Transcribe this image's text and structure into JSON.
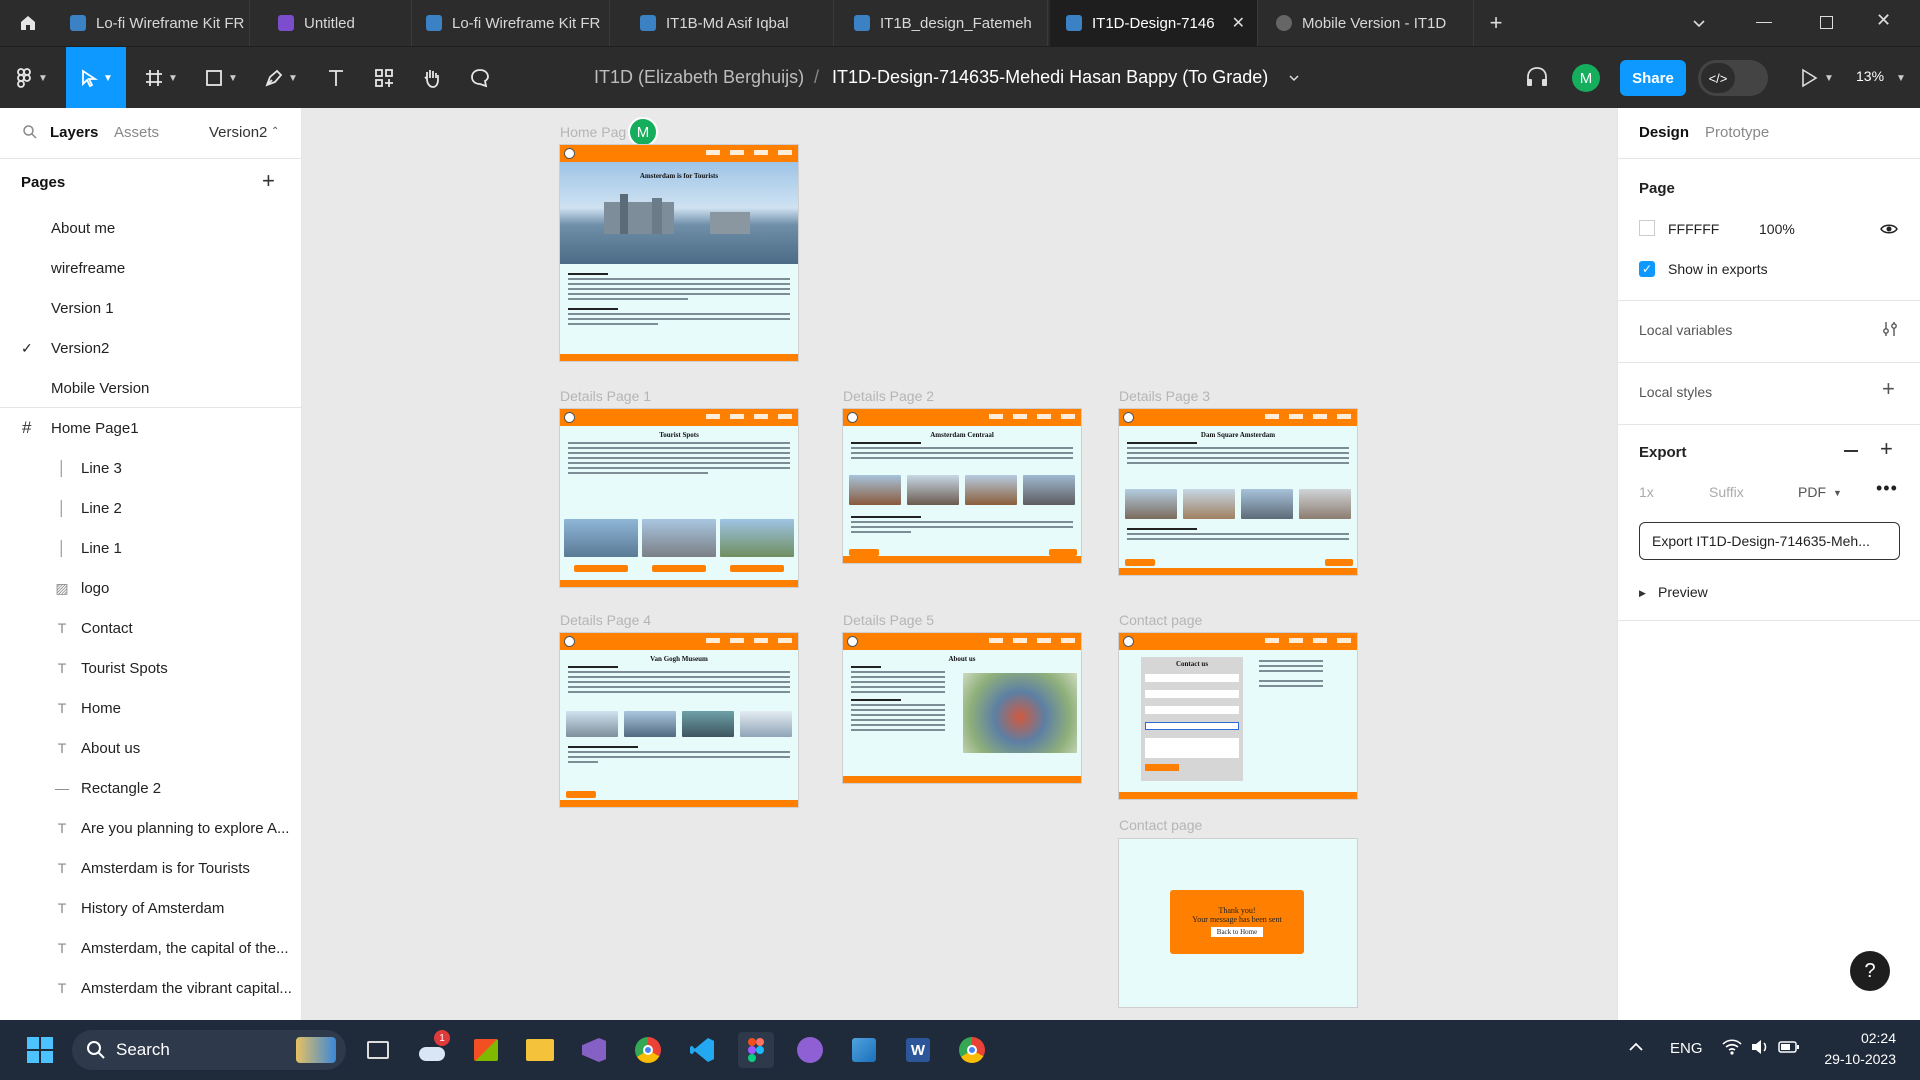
{
  "tabs": [
    {
      "label": "Lo-fi Wireframe Kit FR",
      "color": "#3b82c4"
    },
    {
      "label": "Untitled",
      "color": "#7c4dcc"
    },
    {
      "label": "Lo-fi Wireframe Kit FR",
      "color": "#3b82c4"
    },
    {
      "label": "IT1B-Md Asif Iqbal",
      "color": "#3b82c4"
    },
    {
      "label": "IT1B_design_Fatemeh",
      "color": "#3b82c4"
    },
    {
      "label": "IT1D-Design-7146",
      "color": "#3b82c4"
    },
    {
      "label": "Mobile Version - IT1D",
      "color": "#666666"
    }
  ],
  "toolbar": {
    "breadcrumb_team": "IT1D (Elizabeth Berghuijs)",
    "separator": "/",
    "file_name": "IT1D-Design-714635-Mehedi Hasan Bappy (To Grade)",
    "avatar_letter": "M",
    "share_label": "Share",
    "zoom": "13%"
  },
  "left": {
    "tab_layers": "Layers",
    "tab_assets": "Assets",
    "version": "Version2",
    "pages_title": "Pages",
    "pages": [
      "About me",
      "wirefreame",
      "Version 1",
      "Version2",
      "Mobile Version"
    ],
    "selected_page": "Version2",
    "frame_name": "Home Page1",
    "layers": [
      {
        "label": "Line 3",
        "icon": "line-icon"
      },
      {
        "label": "Line 2",
        "icon": "line-icon"
      },
      {
        "label": "Line 1",
        "icon": "line-icon"
      },
      {
        "label": "logo",
        "icon": "image-icon"
      },
      {
        "label": "Contact",
        "icon": "text-icon"
      },
      {
        "label": "Tourist Spots",
        "icon": "text-icon"
      },
      {
        "label": "Home",
        "icon": "text-icon"
      },
      {
        "label": "About us",
        "icon": "text-icon"
      },
      {
        "label": "Rectangle 2",
        "icon": "rectangle-line-icon"
      },
      {
        "label": "Are you planning to explore A...",
        "icon": "text-icon"
      },
      {
        "label": "Amsterdam is for Tourists",
        "icon": "text-icon"
      },
      {
        "label": "History of Amsterdam",
        "icon": "text-icon"
      },
      {
        "label": "Amsterdam, the capital of the...",
        "icon": "text-icon"
      },
      {
        "label": "Amsterdam the vibrant capital...",
        "icon": "text-icon"
      }
    ]
  },
  "canvas": {
    "labels": [
      "Home Pag",
      "Details Page 1",
      "Details Page 2",
      "Details Page 3",
      "Details Page 4",
      "Details Page 5",
      "Contact page",
      "Contact page"
    ],
    "home_title": "Amsterdam is for Tourists",
    "dp1_title": "Tourist Spots",
    "dp2_title": "Amsterdam Centraal",
    "dp3_title": "Dam Square Amsterdam",
    "dp4_title": "Van Gogh Museum",
    "dp5_title": "About us",
    "contact_title": "Contact us",
    "thanks_line1": "Thank you!",
    "thanks_line2": "Your message has been sent",
    "back_home": "Back to Home",
    "cursor_letter": "M"
  },
  "right": {
    "tab_design": "Design",
    "tab_prototype": "Prototype",
    "page_heading": "Page",
    "page_color": "FFFFFF",
    "page_opacity": "100%",
    "show_in_exports": "Show in exports",
    "local_variables": "Local variables",
    "local_styles": "Local styles",
    "export_heading": "Export",
    "export_scale": "1x",
    "export_suffix": "Suffix",
    "export_format": "PDF",
    "export_button": "Export IT1D-Design-714635-Meh...",
    "preview": "Preview"
  },
  "taskbar": {
    "search": "Search",
    "lang": "ENG",
    "time": "02:24",
    "date": "29-10-2023",
    "notification_count": "1"
  },
  "colors": {
    "accent": "#0d99ff",
    "frame_orange": "#ff8000",
    "frame_bg": "#e8fbfb",
    "avatar_green": "#14ae5c"
  }
}
